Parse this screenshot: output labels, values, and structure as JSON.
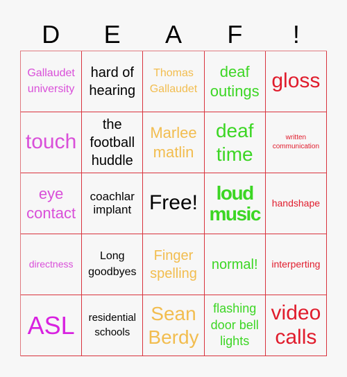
{
  "header": [
    "D",
    "E",
    "A",
    "F",
    "!"
  ],
  "colors": {
    "purple": "#d94fd9",
    "magenta": "#d822e0",
    "black": "#000000",
    "orange": "#f2bd4f",
    "green": "#3cd624",
    "red": "#e01c2c",
    "grid_line": "#d9323c"
  },
  "cells": [
    {
      "text": "Gallaudet university",
      "color": "#d94fd9",
      "size": "fs16"
    },
    {
      "text": "hard of hearing",
      "color": "#000000",
      "size": "fs20"
    },
    {
      "text": "Thomas Gallaudet",
      "color": "#f2bd4f",
      "size": "fs16"
    },
    {
      "text": "deaf outings",
      "color": "#3cd624",
      "size": "fs22"
    },
    {
      "text": "gloss",
      "color": "#e01c2c",
      "size": "fs30"
    },
    {
      "text": "touch",
      "color": "#d94fd9",
      "size": "fs30"
    },
    {
      "text": "the football huddle",
      "color": "#000000",
      "size": "fs20"
    },
    {
      "text": "Marlee matlin",
      "color": "#f2bd4f",
      "size": "fs22"
    },
    {
      "text": "deaf time",
      "color": "#3cd624",
      "size": "fs28"
    },
    {
      "text": "written communication",
      "color": "#e01c2c",
      "size": "fs10"
    },
    {
      "text": "eye contact",
      "color": "#d94fd9",
      "size": "fs22"
    },
    {
      "text": "coachlar implant",
      "color": "#000000",
      "size": "fs17"
    },
    {
      "text": "Free!",
      "color": "#000000",
      "size": "fs30"
    },
    {
      "text": "loud music",
      "color": "#3cd624",
      "size": "fs28",
      "bold": true
    },
    {
      "text": "handshape",
      "color": "#e01c2c",
      "size": "fs14"
    },
    {
      "text": "directness",
      "color": "#d94fd9",
      "size": "fs14"
    },
    {
      "text": "Long goodbyes",
      "color": "#000000",
      "size": "fs16"
    },
    {
      "text": "Finger spelling",
      "color": "#f2bd4f",
      "size": "fs20"
    },
    {
      "text": "normal!",
      "color": "#3cd624",
      "size": "fs20"
    },
    {
      "text": "interperting",
      "color": "#e01c2c",
      "size": "fs14"
    },
    {
      "text": "ASL",
      "color": "#d822e0",
      "size": "fs36"
    },
    {
      "text": "residential schools",
      "color": "#000000",
      "size": "fs15"
    },
    {
      "text": "Sean Berdy",
      "color": "#f2bd4f",
      "size": "fs28"
    },
    {
      "text": "flashing door bell lights",
      "color": "#3cd624",
      "size": "fs18"
    },
    {
      "text": "video calls",
      "color": "#e01c2c",
      "size": "fs30"
    }
  ]
}
